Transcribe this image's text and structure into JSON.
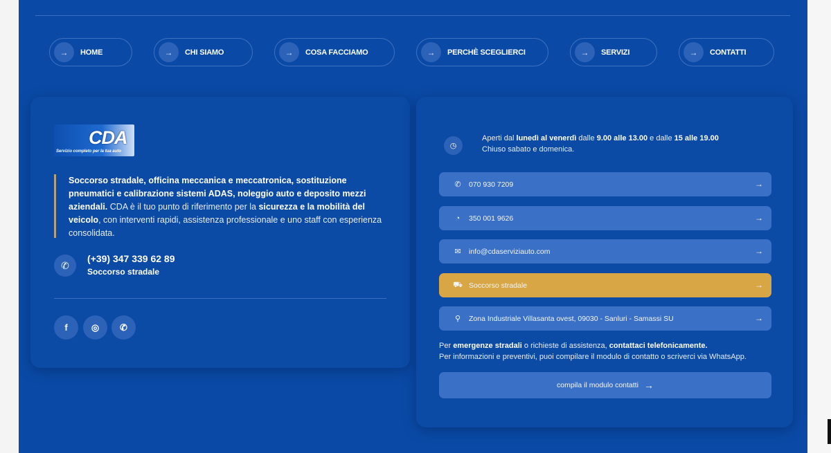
{
  "nav": [
    {
      "label": "HOME",
      "icon": "arrow-right-icon"
    },
    {
      "label": "CHI SIAMO",
      "icon": "arrow-right-icon"
    },
    {
      "label": "COSA FACCIAMO",
      "icon": "arrow-right-icon"
    },
    {
      "label": "PERCHÈ SCEGLIERCI",
      "icon": "arrow-right-icon"
    },
    {
      "label": "SERVIZI",
      "icon": "arrow-right-icon"
    },
    {
      "label": "CONTATTI",
      "icon": "arrow-right-icon"
    }
  ],
  "logo": {
    "mark": "CDA",
    "tagline": "Servizio completo per la tua auto"
  },
  "intro": {
    "bold_1": "Soccorso stradale, officina meccanica e meccatronica, sostituzione pneumatici e calibrazione sistemi ADAS, noleggio auto e deposito mezzi aziendali.",
    "text_1": " CDA è il tuo punto di riferimento per la ",
    "bold_2": "sicurezza e la mobilità del veicolo",
    "text_2": ", con interventi rapidi, assistenza professionale e uno staff con esperienza consolidata."
  },
  "roadside": {
    "phone": "(+39) 347 339 62 89",
    "label": "Soccorso stradale",
    "icon": "phone-call-icon"
  },
  "social": [
    {
      "name": "facebook-icon",
      "glyph": "f"
    },
    {
      "name": "instagram-icon",
      "glyph": "◎"
    },
    {
      "name": "whatsapp-icon",
      "glyph": "✆"
    }
  ],
  "hours": {
    "t1": "Aperti dal ",
    "b1": "lunedì al venerdì",
    "t2": " dalle ",
    "b2": "9.00 alle 13.00",
    "t3": " e dalle ",
    "b3": "15 alle 19.00",
    "line2": "Chiuso sabato e domenica.",
    "icon": "clock-icon"
  },
  "contacts": [
    {
      "label": "070 930 7209",
      "icon": "phone-icon",
      "glyph": "✆"
    },
    {
      "label": "350 001 9626",
      "icon": "whatsapp-icon",
      "glyph": "◔"
    },
    {
      "label": "info@cdaserviziauto.com",
      "icon": "envelope-icon",
      "glyph": "✉"
    },
    {
      "label": "Soccorso stradale",
      "icon": "tow-truck-icon",
      "glyph": "⛟"
    },
    {
      "label": "Zona Industriale Villasanta ovest, 09030 - Sanluri - Samassi SU",
      "icon": "map-pin-icon",
      "glyph": "⚲"
    }
  ],
  "note": {
    "t1": "Per ",
    "b1": "emergenze stradali",
    "t2": " o richieste di assistenza, ",
    "b2": "contattaci telefonicamente.",
    "line2": "Per informazioni e preventivi, puoi compilare il modulo di contatto o scriverci via WhatsApp."
  },
  "form_button": "compila il modulo contatti",
  "colors": {
    "panel": "#0a4aa6",
    "button": "#3a70c6",
    "accent": "#d8a645"
  }
}
